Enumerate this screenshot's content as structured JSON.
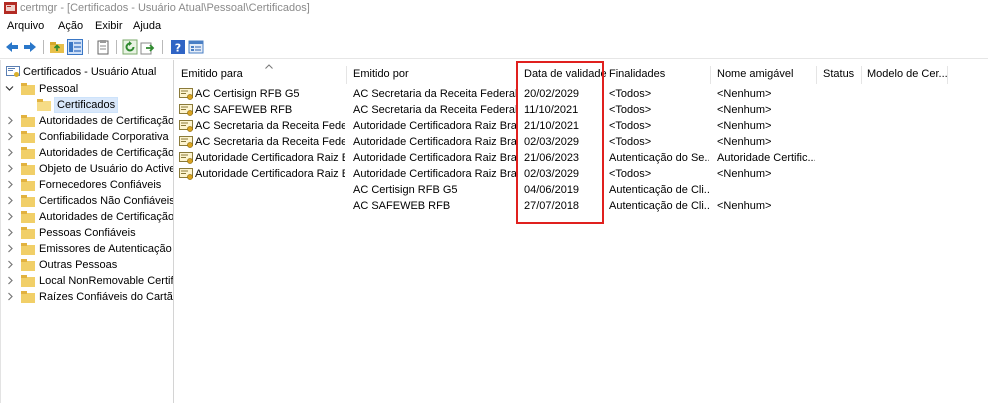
{
  "window": {
    "title": "certmgr - [Certificados - Usuário Atual\\Pessoal\\Certificados]",
    "app_icon": "certmgr-icon"
  },
  "menu": [
    "Arquivo",
    "Ação",
    "Exibir",
    "Ajuda"
  ],
  "toolbar": [
    "back-icon",
    "forward-icon",
    "up-folder-icon",
    "show-tree-icon",
    "copy-icon",
    "refresh-icon",
    "export-icon",
    "help-icon",
    "properties-icon"
  ],
  "tree": {
    "root": "Certificados - Usuário Atual",
    "items": [
      {
        "label": "Pessoal",
        "expanded": true
      },
      {
        "label": "Certificados",
        "selected": true
      },
      {
        "label": "Autoridades de Certificação R"
      },
      {
        "label": "Confiabilidade Corporativa"
      },
      {
        "label": "Autoridades de Certificação I"
      },
      {
        "label": "Objeto de Usuário do Active I"
      },
      {
        "label": "Fornecedores Confiáveis"
      },
      {
        "label": "Certificados Não Confiáveis"
      },
      {
        "label": "Autoridades de Certificação R"
      },
      {
        "label": "Pessoas Confiáveis"
      },
      {
        "label": "Emissores de Autenticação de"
      },
      {
        "label": "Outras Pessoas"
      },
      {
        "label": "Local NonRemovable Certific"
      },
      {
        "label": "Raízes Confiáveis do Cartão In"
      }
    ]
  },
  "list": {
    "columns": [
      "Emitido para",
      "Emitido por",
      "Data de validade",
      "Finalidades",
      "Nome amigável",
      "Status",
      "Modelo de Cer..."
    ],
    "rows": [
      {
        "to": "AC Certisign RFB G5",
        "by": "AC Secretaria da Receita Federal d...",
        "date": "20/02/2029",
        "purpose": "<Todos>",
        "name": "<Nenhum>",
        "icon": true
      },
      {
        "to": "AC SAFEWEB RFB",
        "by": "AC Secretaria da Receita Federal d...",
        "date": "11/10/2021",
        "purpose": "<Todos>",
        "name": "<Nenhum>",
        "icon": true
      },
      {
        "to": "AC Secretaria da Receita Federa...",
        "by": "Autoridade Certificadora Raiz Bras...",
        "date": "21/10/2021",
        "purpose": "<Todos>",
        "name": "<Nenhum>",
        "icon": true
      },
      {
        "to": "AC Secretaria da Receita Federa...",
        "by": "Autoridade Certificadora Raiz Bras...",
        "date": "02/03/2029",
        "purpose": "<Todos>",
        "name": "<Nenhum>",
        "icon": true
      },
      {
        "to": "Autoridade Certificadora Raiz B...",
        "by": "Autoridade Certificadora Raiz Bras...",
        "date": "21/06/2023",
        "purpose": "Autenticação do Se...",
        "name": "Autoridade Certific...",
        "icon": true
      },
      {
        "to": "Autoridade Certificadora Raiz B...",
        "by": "Autoridade Certificadora Raiz Bras...",
        "date": "02/03/2029",
        "purpose": "<Todos>",
        "name": "<Nenhum>",
        "icon": true
      },
      {
        "to": "",
        "by": "AC Certisign RFB G5",
        "date": "04/06/2019",
        "purpose": "Autenticação de Cli...",
        "name": "",
        "icon": false
      },
      {
        "to": "",
        "by": "AC SAFEWEB RFB",
        "date": "27/07/2018",
        "purpose": "Autenticação de Cli...",
        "name": "<Nenhum>",
        "icon": false
      }
    ]
  },
  "highlight_color": "#e0201e"
}
